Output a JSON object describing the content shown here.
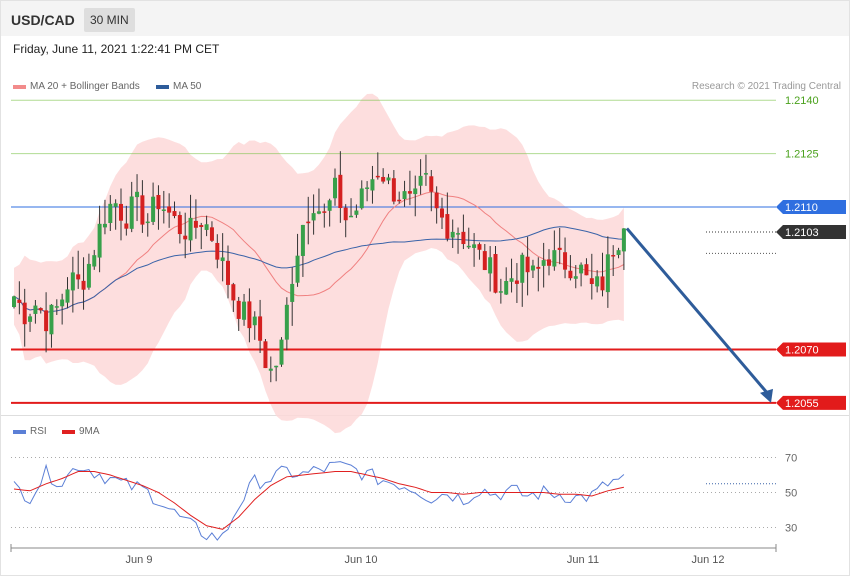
{
  "header": {
    "symbol": "USD/CAD",
    "timeframe": "30 MIN"
  },
  "timestamp": "Friday, June 11, 2021 1:22:41 PM CET",
  "copyright": "Research © 2021 Trading Central",
  "legend_main": [
    {
      "label": "MA 20 + Bollinger Bands",
      "color": "#f28b8b"
    },
    {
      "label": "MA 50",
      "color": "#2e5c9a"
    }
  ],
  "legend_rsi": [
    {
      "label": "RSI",
      "color": "#5b7fd6"
    },
    {
      "label": "9MA",
      "color": "#e02020"
    }
  ],
  "chart_data": [
    {
      "type": "candlestick",
      "ylim": [
        1.2053,
        1.2144
      ],
      "x_ticks": [
        "Jun 9",
        "Jun 10",
        "Jun 11",
        "Jun 12"
      ],
      "levels": [
        {
          "value": 1.214,
          "label": "1.2140",
          "color": "#7cc34a",
          "kind": "resistance"
        },
        {
          "value": 1.2125,
          "label": "1.2125",
          "color": "#7cc34a",
          "kind": "resistance"
        },
        {
          "value": 1.211,
          "label": "1.2110",
          "color": "#2f6fe0",
          "kind": "pivot"
        },
        {
          "value": 1.2103,
          "label": "1.2103",
          "color": "#333333",
          "kind": "last_price"
        },
        {
          "value": 1.207,
          "label": "1.2070",
          "color": "#e21b1b",
          "kind": "support"
        },
        {
          "value": 1.2055,
          "label": "1.2055",
          "color": "#e21b1b",
          "kind": "support"
        }
      ],
      "close_path": [
        1.2085,
        1.208,
        1.2083,
        1.2078,
        1.2082,
        1.209,
        1.2088,
        1.2096,
        1.2107,
        1.2112,
        1.2107,
        1.2111,
        1.2106,
        1.2112,
        1.2108,
        1.2104,
        1.2103,
        1.2107,
        1.2101,
        1.2092,
        1.2083,
        1.2079,
        1.2075,
        1.2063,
        1.2068,
        1.209,
        1.2105,
        1.2112,
        1.2107,
        1.2115,
        1.2106,
        1.211,
        1.2117,
        1.2121,
        1.2115,
        1.2113,
        1.211,
        1.2118,
        1.2109,
        1.2105,
        1.2104,
        1.21,
        1.2096,
        1.2092,
        1.2087,
        1.2091,
        1.2093,
        1.209,
        1.2097,
        1.2095,
        1.2094,
        1.2093,
        1.2087,
        1.2088,
        1.2099,
        1.2104
      ],
      "projection": {
        "from": 1.2104,
        "to": 1.2055
      }
    },
    {
      "type": "line",
      "title": "RSI",
      "ylim": [
        20,
        80
      ],
      "y_ticks": [
        70,
        50,
        30
      ],
      "series": [
        {
          "name": "RSI",
          "values": [
            53,
            48,
            61,
            56,
            66,
            62,
            58,
            54,
            52,
            46,
            38,
            31,
            26,
            24,
            43,
            56,
            58,
            62,
            60,
            63,
            65,
            64,
            60,
            57,
            55,
            52,
            47,
            50,
            46,
            52,
            49,
            51,
            48,
            50,
            49,
            47,
            48,
            55,
            58
          ]
        },
        {
          "name": "9MA",
          "values": [
            52,
            51,
            55,
            58,
            62,
            62,
            60,
            57,
            54,
            50,
            44,
            37,
            31,
            29,
            36,
            46,
            54,
            59,
            60,
            61,
            62,
            62,
            60,
            58,
            55,
            53,
            50,
            50,
            49,
            50,
            50,
            50,
            50,
            50,
            49,
            49,
            48,
            51,
            53
          ]
        }
      ]
    }
  ]
}
